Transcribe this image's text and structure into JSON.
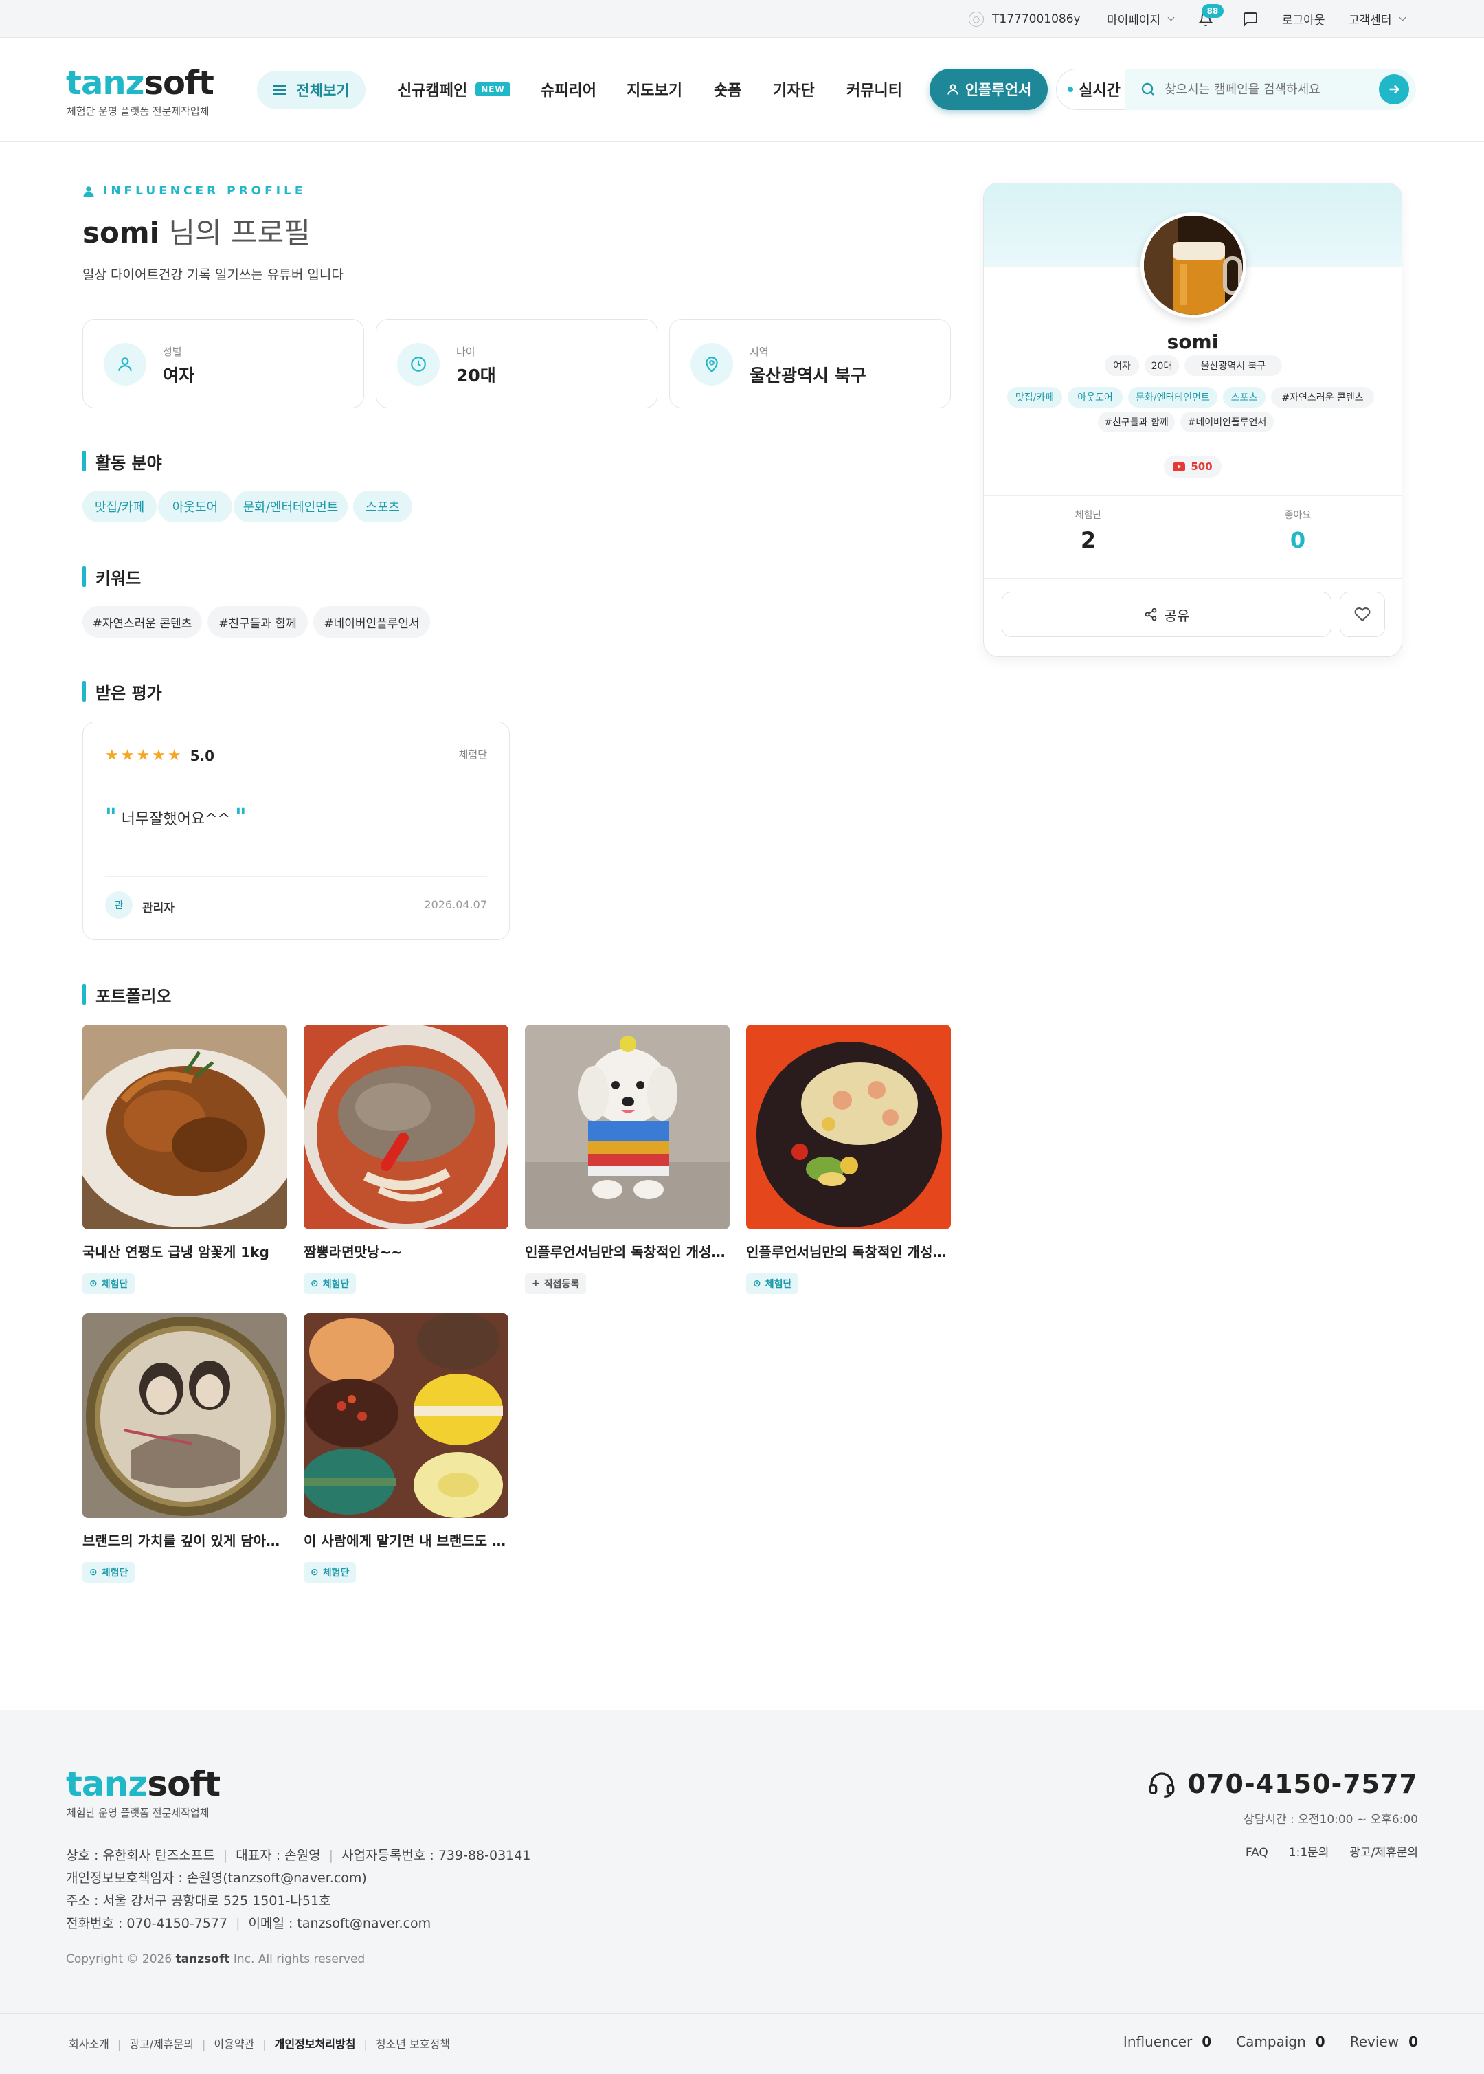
{
  "topbar": {
    "user_id": "T1777001086y",
    "mypage": "마이페이지",
    "notif_count": "88",
    "logout": "로그아웃",
    "support": "고객센터"
  },
  "header": {
    "logo_a": "tanz",
    "logo_b": "soft",
    "logo_sub": "체험단 운영 플랫폼 전문제작업체",
    "all_btn": "전체보기",
    "nav": [
      "신규캠페인",
      "슈피리어",
      "지도보기",
      "숏폼",
      "기자단",
      "커뮤니티"
    ],
    "new_tag": "NEW",
    "influencer_btn": "인플루언서",
    "realtime": "실시간",
    "search_placeholder": "찾으시는 캠페인을 검색하세요"
  },
  "profile": {
    "eyebrow": "INFLUENCER PROFILE",
    "name": "somi",
    "title_rest": " 님의 프로필",
    "desc": "일상 다이어트건강 기록 일기쓰는 유튜버 입니다",
    "info": [
      {
        "label": "성별",
        "value": "여자",
        "icon": "person-icon"
      },
      {
        "label": "나이",
        "value": "20대",
        "icon": "clock-icon"
      },
      {
        "label": "지역",
        "value": "울산광역시 북구",
        "icon": "location-pin-icon"
      }
    ]
  },
  "sections": {
    "activity": "활동 분야",
    "keywords": "키워드",
    "reviews": "받은 평가",
    "portfolio": "포트폴리오"
  },
  "activity_tags": [
    "맛집/카페",
    "아웃도어",
    "문화/엔터테인먼트",
    "스포츠"
  ],
  "keyword_tags": [
    "#자연스러운 콘텐츠",
    "#친구들과 함께",
    "#네이버인플루언서"
  ],
  "review": {
    "stars": "★★★★★",
    "score": "5.0",
    "type": "체험단",
    "open_quote": "\"",
    "text": " 너무잘했어요^^ ",
    "close_quote": "\"",
    "avatar_char": "관",
    "author": "관리자",
    "date": "2026.04.07"
  },
  "portfolio": [
    {
      "title": "국내산 연평도 급냉 암꽃게 1kg",
      "badge": "체험단",
      "badge_icon": "check-circle-icon"
    },
    {
      "title": "짬뽕라면맛낭~~",
      "badge": "체험단",
      "badge_icon": "check-circle-icon"
    },
    {
      "title": "인플루언서님만의 독창적인 개성이...",
      "badge": "직접등록",
      "badge_icon": "plus-icon"
    },
    {
      "title": "인플루언서님만의 독창적인 개성이...",
      "badge": "체험단",
      "badge_icon": "check-circle-icon"
    },
    {
      "title": "브랜드의 가치를 깊이 있게 담아낼...",
      "badge": "체험단",
      "badge_icon": "check-circle-icon"
    },
    {
      "title": "이 사람에게 맡기면 내 브랜드도 고...",
      "badge": "체험단",
      "badge_icon": "check-circle-icon"
    }
  ],
  "card": {
    "name": "somi",
    "info_chips": [
      "여자",
      "20대",
      "울산광역시 북구"
    ],
    "tags": [
      "맛집/카페",
      "아웃도어",
      "문화/엔터테인먼트",
      "스포츠"
    ],
    "keywords": [
      "#자연스러운 콘텐츠",
      "#친구들과 함께",
      "#네이버인플루언서"
    ],
    "youtube": "500",
    "stats": [
      {
        "label": "체험단",
        "value": "2"
      },
      {
        "label": "좋아요",
        "value": "0"
      }
    ],
    "share": "공유"
  },
  "footer": {
    "logo_a": "tanz",
    "logo_b": "soft",
    "logo_sub": "체험단 운영 플랫폼 전문제작업체",
    "company": "상호 : 유한회사 탄즈소프트",
    "ceo": "대표자 : 손원영",
    "bizno": "사업자등록번호 : 739-88-03141",
    "privacy_officer": "개인정보보호책임자 : 손원영(tanzsoft@naver.com)",
    "address": "주소 : 서울 강서구 공항대로 525 1501-나51호",
    "tel": "전화번호 : 070-4150-7577",
    "email": "이메일 : tanzsoft@naver.com",
    "copy_pre": "Copyright © 2026 ",
    "copy_brand": "tanzsoft",
    "copy_post": " Inc. All rights reserved",
    "phone": "070-4150-7577",
    "hours": "상담시간 : 오전10:00 ~ 오후6:00",
    "links": [
      "FAQ",
      "1:1문의",
      "광고/제휴문의"
    ],
    "bottom_links": [
      "회사소개",
      "광고/제휴문의",
      "이용약관",
      "개인정보처리방침",
      "청소년 보호정책"
    ],
    "counts": [
      {
        "label": "Influencer",
        "value": "0"
      },
      {
        "label": "Campaign",
        "value": "0"
      },
      {
        "label": "Review",
        "value": "0"
      }
    ]
  },
  "colors": {
    "accent": "#20b7c8",
    "accent_dark": "#1f8898",
    "star": "#f5a623",
    "youtube": "#e53935"
  }
}
